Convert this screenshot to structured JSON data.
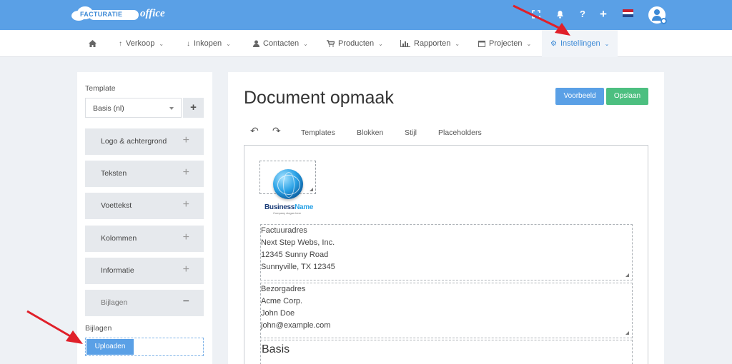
{
  "topbar": {
    "logo_main": "FACTURATIE",
    "logo_sub": "office",
    "icons": [
      "fullscreen-icon",
      "bell-icon",
      "help-icon",
      "plus-icon",
      "flag-nl-icon",
      "user-avatar-icon"
    ],
    "help_glyph": "?",
    "plus_glyph": "+"
  },
  "nav": {
    "items": [
      {
        "label": "",
        "icon": "home-icon"
      },
      {
        "label": "Verkoop",
        "icon": "arrow-up-icon"
      },
      {
        "label": "Inkopen",
        "icon": "arrow-down-icon"
      },
      {
        "label": "Contacten",
        "icon": "user-icon"
      },
      {
        "label": "Producten",
        "icon": "cart-icon"
      },
      {
        "label": "Rapporten",
        "icon": "bar-chart-icon"
      },
      {
        "label": "Projecten",
        "icon": "calendar-icon"
      },
      {
        "label": "Instellingen",
        "icon": "gear-icon",
        "active": true
      }
    ]
  },
  "sidebar": {
    "template_label": "Template",
    "template_value": "Basis (nl)",
    "add_glyph": "+",
    "sections": [
      {
        "label": "Logo & achtergrond",
        "sign": "+"
      },
      {
        "label": "Teksten",
        "sign": "+"
      },
      {
        "label": "Voettekst",
        "sign": "+"
      },
      {
        "label": "Kolommen",
        "sign": "+"
      },
      {
        "label": "Informatie",
        "sign": "+"
      },
      {
        "label": "Bijlagen",
        "sign": "−"
      }
    ],
    "attachments_label": "Bijlagen",
    "upload_label": "Uploaden"
  },
  "main": {
    "title": "Document opmaak",
    "preview_label": "Voorbeeld",
    "save_label": "Opslaan",
    "toolbar": [
      "Templates",
      "Blokken",
      "Stijl",
      "Placeholders"
    ],
    "logo": {
      "name_a": "Business",
      "name_b": "Name",
      "slogan": "Company slogan here"
    },
    "invoice_address": [
      "Factuuradres",
      "Next Step Webs, Inc.",
      "12345 Sunny Road",
      "Sunnyville, TX 12345"
    ],
    "delivery_address": [
      "Bezorgadres",
      "Acme Corp.",
      "John Doe",
      "john@example.com"
    ],
    "basis_heading": "Basis"
  },
  "colors": {
    "topbar": "#5aa0e6",
    "accent": "#3d8ad6",
    "save": "#4cbf80",
    "arrow": "#e0202a"
  }
}
